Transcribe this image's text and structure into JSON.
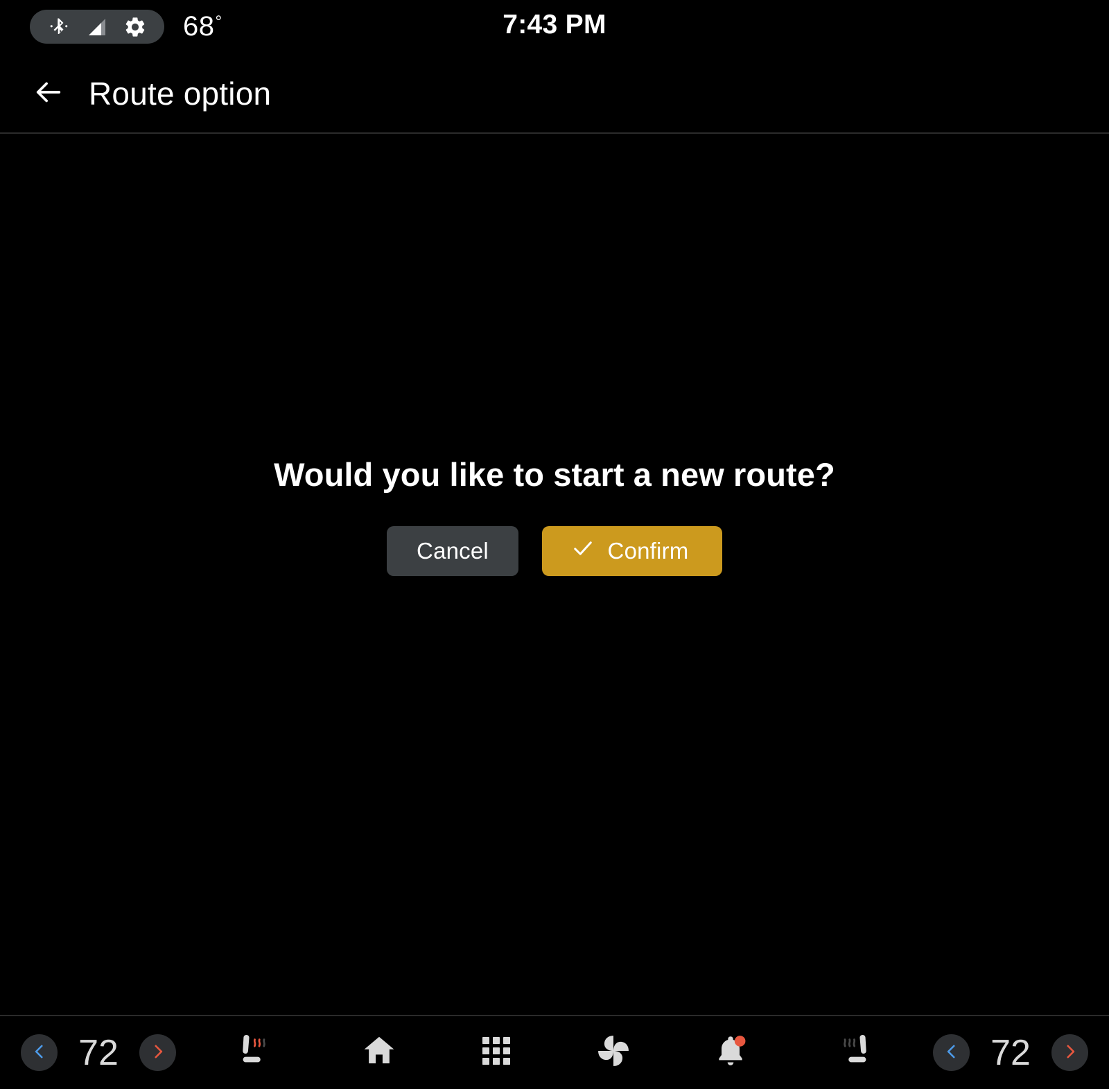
{
  "status_bar": {
    "bluetooth_icon": "bluetooth-icon",
    "signal_icon": "cell-signal-icon",
    "settings_icon": "gear-icon",
    "outside_temp": "68",
    "degree_symbol": "°",
    "clock": "7:43 PM"
  },
  "app_bar": {
    "back_icon": "arrow-left-icon",
    "title": "Route option"
  },
  "dialog": {
    "message": "Would you like to start a new route?",
    "cancel_label": "Cancel",
    "confirm_label": "Confirm",
    "confirm_icon": "check-icon"
  },
  "bottom_bar": {
    "left_climate": {
      "decrease_icon": "chevron-left-icon",
      "temperature": "72",
      "increase_icon": "chevron-right-icon",
      "seat_icon": "heated-seat-icon"
    },
    "right_climate": {
      "seat_icon": "heated-seat-icon",
      "decrease_icon": "chevron-left-icon",
      "temperature": "72",
      "increase_icon": "chevron-right-icon"
    },
    "nav_items": [
      {
        "name": "home",
        "icon": "home-icon"
      },
      {
        "name": "apps",
        "icon": "apps-grid-icon"
      },
      {
        "name": "climate",
        "icon": "fan-icon"
      },
      {
        "name": "notifications",
        "icon": "bell-icon",
        "badge": true
      }
    ]
  },
  "colors": {
    "background": "#000000",
    "confirm_accent": "#cc9a1e",
    "cancel_surface": "#3c4043",
    "pill_surface": "#3c4043",
    "chevron_cool": "#4d9ae8",
    "chevron_warm": "#e8573f",
    "badge": "#e8573f",
    "icon_default": "#dadada",
    "divider": "#2b2b2b"
  }
}
